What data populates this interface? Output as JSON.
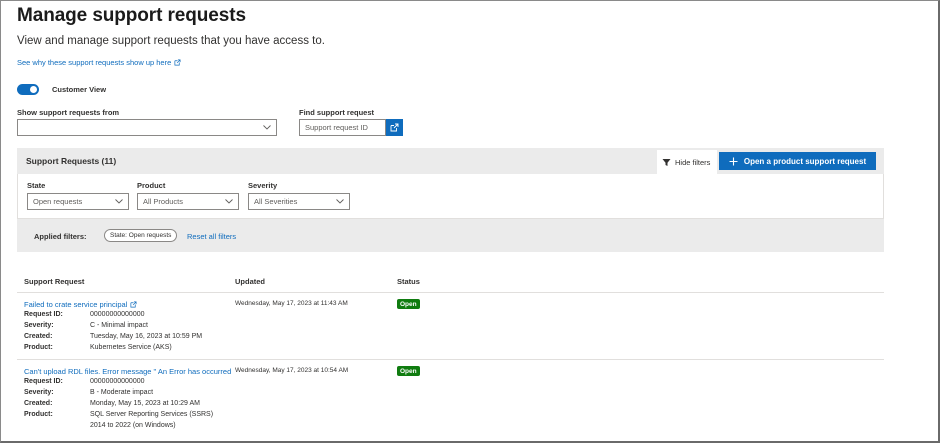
{
  "header": {
    "title": "Manage support requests",
    "subtitle": "View and manage support requests that you have access to.",
    "see_why_link": "See why these support requests show up here"
  },
  "customer_view": {
    "label": "Customer View",
    "enabled": true
  },
  "show_from": {
    "label": "Show support requests from",
    "value": ""
  },
  "find": {
    "label": "Find support request",
    "placeholder": "Support request ID"
  },
  "panel": {
    "title": "Support Requests (11)",
    "hide_filters_label": "Hide filters",
    "open_request_label": "Open a product support request"
  },
  "filters": {
    "state": {
      "label": "State",
      "value": "Open requests"
    },
    "product": {
      "label": "Product",
      "value": "All Products"
    },
    "severity": {
      "label": "Severity",
      "value": "All Severities"
    }
  },
  "applied": {
    "label": "Applied filters:",
    "chip": "State: Open requests",
    "reset_label": "Reset all filters"
  },
  "table": {
    "columns": [
      "Support Request",
      "Updated",
      "Status"
    ],
    "field_labels": {
      "id": "Request ID:",
      "severity": "Severity:",
      "created": "Created:",
      "product": "Product:"
    },
    "rows": [
      {
        "title": "Failed to crate service principal",
        "id": "00000000000000",
        "severity": "C - Minimal impact",
        "created": "Tuesday, May 16, 2023 at 10:59 PM",
        "product": "Kubernetes Service (AKS)",
        "product_line2": "",
        "updated": "Wednesday, May 17, 2023 at 11:43 AM",
        "status": "Open"
      },
      {
        "title": "Can't upload RDL files. Error message \" An Error has occurred",
        "id": "00000000000000",
        "severity": "B - Moderate impact",
        "created": "Monday, May 15, 2023 at 10:29 AM",
        "product": "SQL Server Reporting Services (SSRS)",
        "product_line2": "2014 to 2022 (on Windows)",
        "updated": "Wednesday, May 17, 2023 at 10:54 AM",
        "status": "Open"
      }
    ]
  },
  "colors": {
    "accent": "#0f6cbd",
    "status_open": "#107c10",
    "panel_bg": "#ebebeb"
  }
}
